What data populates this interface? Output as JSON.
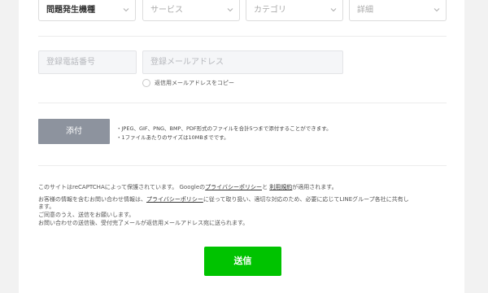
{
  "selects": [
    {
      "label": "問題発生機種",
      "active": true
    },
    {
      "label": "サービス",
      "active": false
    },
    {
      "label": "カテゴリ",
      "active": false
    },
    {
      "label": "詳細",
      "active": false
    }
  ],
  "phone_field": {
    "placeholder": "登録電話番号"
  },
  "email_field": {
    "placeholder": "登録メールアドレス"
  },
  "copy_option": {
    "label": "返信用メールアドレスをコピー"
  },
  "attach": {
    "button_label": "添付",
    "notes": [
      "・JPEG、GIF、PNG、BMP、PDF形式のファイルを合計5つまで添付することができます。",
      "・1ファイルあたりのサイズは10MBまでです。"
    ]
  },
  "legal": {
    "recaptcha_prefix": "このサイトはreCAPTCHAによって保護されています。 Googleの",
    "privacy_policy": "プライバシーポリシー",
    "and": "と ",
    "terms": "利用規約",
    "recaptcha_suffix": "が適用されます。",
    "info_prefix": "お客様の情報を含むお問い合わせ情報は、",
    "line_privacy_policy": "プライバシーポリシー",
    "info_suffix_1": "に従って取り扱い、適切な対応のため、必要に応じてLINEグループ各社に共有し",
    "info_suffix_2": "ます。",
    "consent": "ご同意のうえ、送信をお願いします。",
    "after_send": "お問い合わせの送信後、受付完了メールが返信用メールアドレス宛に送られます。"
  },
  "submit": {
    "label": "送信"
  },
  "colors": {
    "submit": "#00c300",
    "attach": "#8d939e",
    "background": "#f2f2f2"
  }
}
